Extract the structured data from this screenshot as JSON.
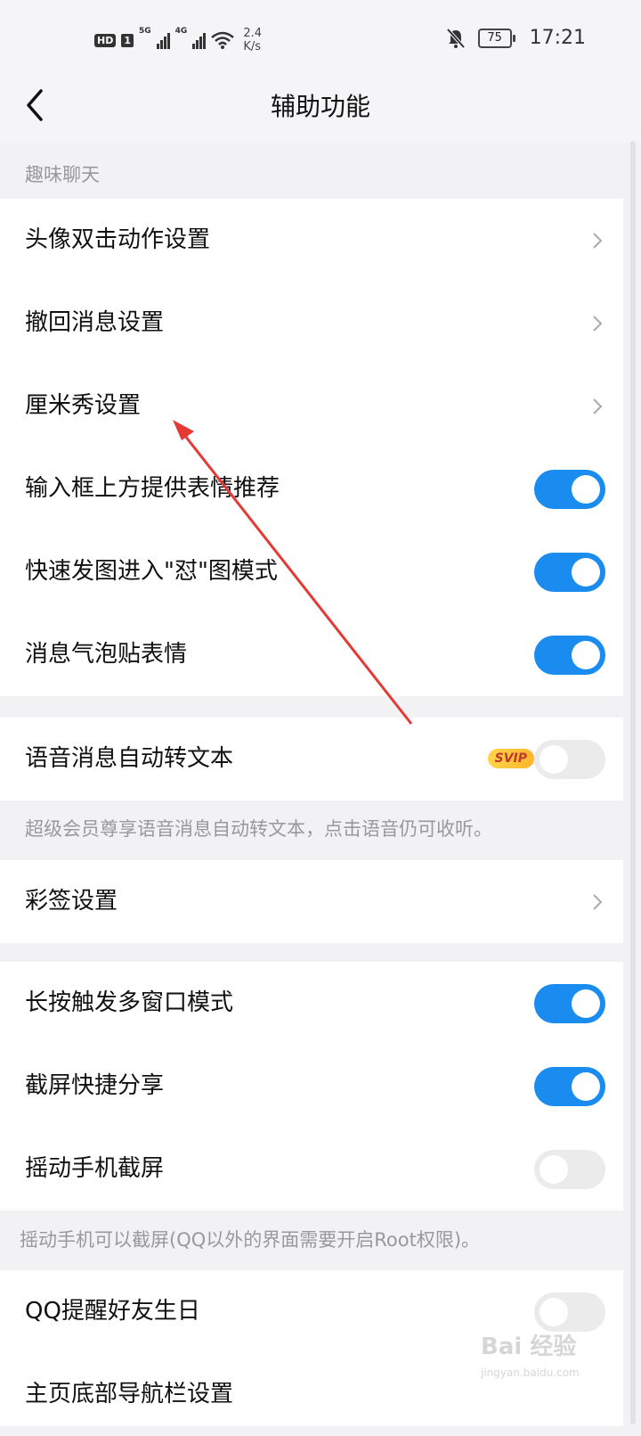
{
  "status_bar": {
    "hd": "HD",
    "sim": "1",
    "gen1": "5G",
    "gen2": "4G",
    "speed_value": "2.4",
    "speed_unit": "K/s",
    "battery": "75",
    "time": "17:21"
  },
  "navbar": {
    "title": "辅助功能"
  },
  "section_title": "趣味聊天",
  "group1": [
    {
      "label": "头像双击动作设置",
      "control": "chevron"
    },
    {
      "label": "撤回消息设置",
      "control": "chevron"
    },
    {
      "label": "厘米秀设置",
      "control": "chevron"
    },
    {
      "label": "输入框上方提供表情推荐",
      "control": "toggle",
      "on": true
    },
    {
      "label": "快速发图进入\"怼\"图模式",
      "control": "toggle",
      "on": true
    },
    {
      "label": "消息气泡贴表情",
      "control": "toggle",
      "on": true
    }
  ],
  "voice_row": {
    "label": "语音消息自动转文本",
    "badge": "SVIP",
    "on": false
  },
  "voice_note": "超级会员尊享语音消息自动转文本，点击语音仍可收听。",
  "caiqian_row": {
    "label": "彩签设置",
    "control": "chevron"
  },
  "group3": [
    {
      "label": "长按触发多窗口模式",
      "on": true
    },
    {
      "label": "截屏快捷分享",
      "on": true
    },
    {
      "label": "摇动手机截屏",
      "on": false
    }
  ],
  "shake_note": "摇动手机可以截屏(QQ以外的界面需要开启Root权限)。",
  "birthday_row": {
    "label": "QQ提醒好友生日",
    "on": false
  },
  "bottom_row": {
    "label": "主页底部导航栏设置"
  },
  "watermark": {
    "text": "Bai 经验",
    "sub": "jingyan.baidu.com"
  },
  "colors": {
    "toggle_on": "#1a8cf0",
    "toggle_off": "#ebebeb",
    "annotation_arrow": "#e53935"
  }
}
